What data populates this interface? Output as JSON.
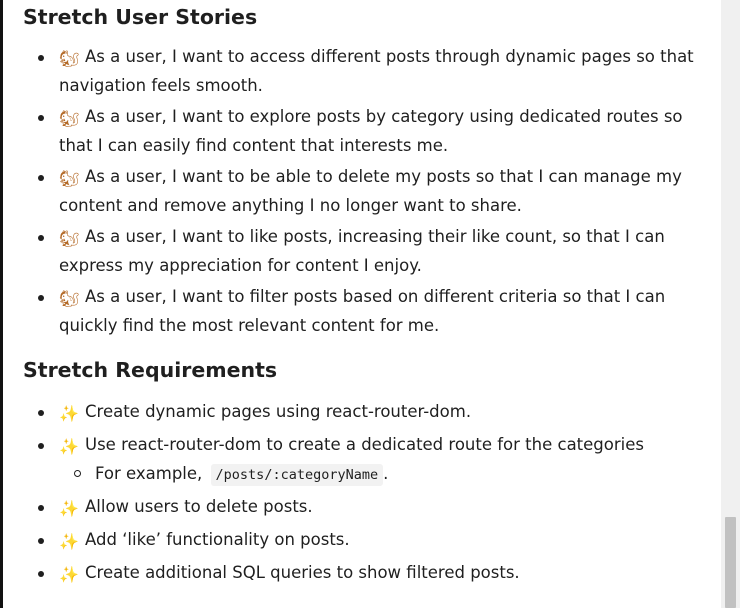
{
  "stretch_stories": {
    "heading": "Stretch User Stories",
    "icon": "squirrel-emoji",
    "items": [
      "As a user, I want to access different posts through dynamic pages so that navigation feels smooth.",
      "As a user, I want to explore posts by category using dedicated routes so that I can easily find content that interests me.",
      "As a user, I want to be able to delete my posts so that I can manage my content and remove anything I no longer want to share.",
      "As a user, I want to like posts, increasing their like count, so that I can express my appreciation for content I enjoy.",
      "As a user, I want to filter posts based on different criteria so that I can quickly find the most relevant content for me."
    ]
  },
  "stretch_requirements": {
    "heading": "Stretch Requirements",
    "icon": "magic-wand-emoji",
    "items": [
      "Create dynamic pages using react-router-dom.",
      "Use react-router-dom to create a dedicated route for the categories",
      "Allow users to delete posts.",
      "Add ‘like’ functionality on posts.",
      "Create additional SQL queries to show filtered posts."
    ],
    "sub_item": {
      "prefix": "For example,",
      "code": "/posts/:categoryName",
      "suffix": "."
    }
  }
}
